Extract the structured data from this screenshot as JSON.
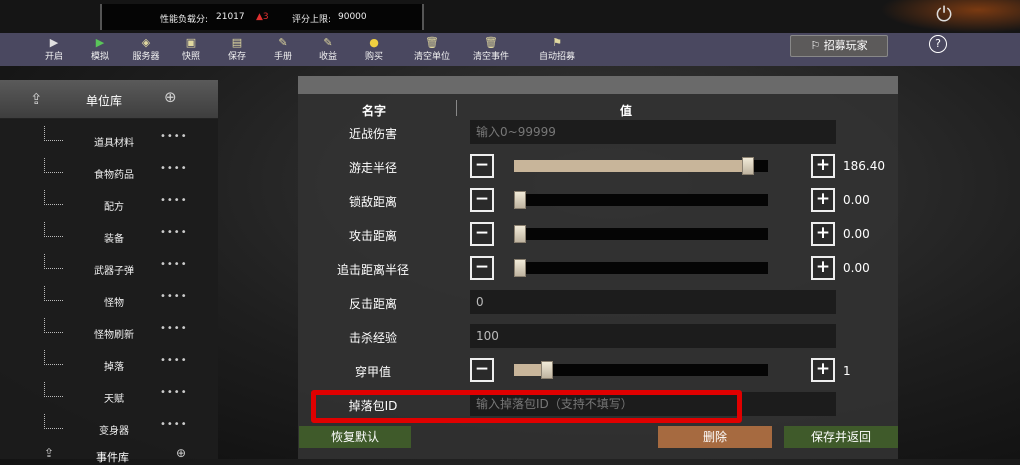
{
  "topbar": {
    "perf_label": "性能负载分:",
    "perf_value": "21017",
    "perf_delta": "▲3",
    "score_limit_label": "评分上限:",
    "score_limit_value": "90000",
    "power_icon": "power-icon"
  },
  "toolbar": {
    "items": [
      {
        "label": "开启",
        "icon": "play-icon",
        "color": "#e0e0e0"
      },
      {
        "label": "模拟",
        "icon": "play-green-icon",
        "color": "#5ac55a"
      },
      {
        "label": "服务器",
        "icon": "server-icon",
        "color": "#e0d8a0"
      },
      {
        "label": "快照",
        "icon": "snapshot-icon",
        "color": "#e0d8a0"
      },
      {
        "label": "保存",
        "icon": "save-icon",
        "color": "#e0d8a0"
      },
      {
        "label": "手册",
        "icon": "manual-icon",
        "color": "#e0d8a0"
      },
      {
        "label": "收益",
        "icon": "income-icon",
        "color": "#e0d8a0"
      },
      {
        "label": "购买",
        "icon": "buy-icon",
        "color": "#f0d040"
      },
      {
        "label": "清空单位",
        "icon": "trash-icon",
        "color": "#e0d8a0"
      },
      {
        "label": "清空事件",
        "icon": "trash-icon",
        "color": "#e0d8a0"
      },
      {
        "label": "自动招募",
        "icon": "flag-icon",
        "color": "#e0d8a0"
      }
    ],
    "recruit_label": "招募玩家",
    "help_label": "?"
  },
  "sidebar": {
    "header": "单位库",
    "items": [
      "道具材料",
      "食物药品",
      "配方",
      "装备",
      "武器子弹",
      "怪物",
      "怪物刷新",
      "掉落",
      "天赋",
      "变身器"
    ],
    "footer": "事件库"
  },
  "panel": {
    "col_name": "名字",
    "col_value": "值",
    "rows": [
      {
        "label": "近战伤害",
        "type": "text",
        "placeholder": "输入0~99999"
      },
      {
        "label": "游走半径",
        "type": "slider",
        "value": "186.40",
        "fraction": 0.92
      },
      {
        "label": "锁敌距离",
        "type": "slider",
        "value": "0.00",
        "fraction": 0.0
      },
      {
        "label": "攻击距离",
        "type": "slider",
        "value": "0.00",
        "fraction": 0.0
      },
      {
        "label": "追击距离半径",
        "type": "slider",
        "value": "0.00",
        "fraction": 0.0
      },
      {
        "label": "反击距离",
        "type": "text",
        "value": "0"
      },
      {
        "label": "击杀经验",
        "type": "text",
        "value": "100"
      },
      {
        "label": "穿甲值",
        "type": "slider",
        "value": "1",
        "fraction": 0.13
      },
      {
        "label": "掉落包ID",
        "type": "text",
        "placeholder": "输入掉落包ID（支持不填写）"
      }
    ]
  },
  "buttons": {
    "reset": "恢复默认",
    "delete": "删除",
    "save_return": "保存并返回"
  },
  "colors": {
    "highlight_box": "#e00000",
    "reset_btn": "#3f5a2a",
    "delete_btn": "#a66a40",
    "save_btn": "#3f5a2a"
  }
}
